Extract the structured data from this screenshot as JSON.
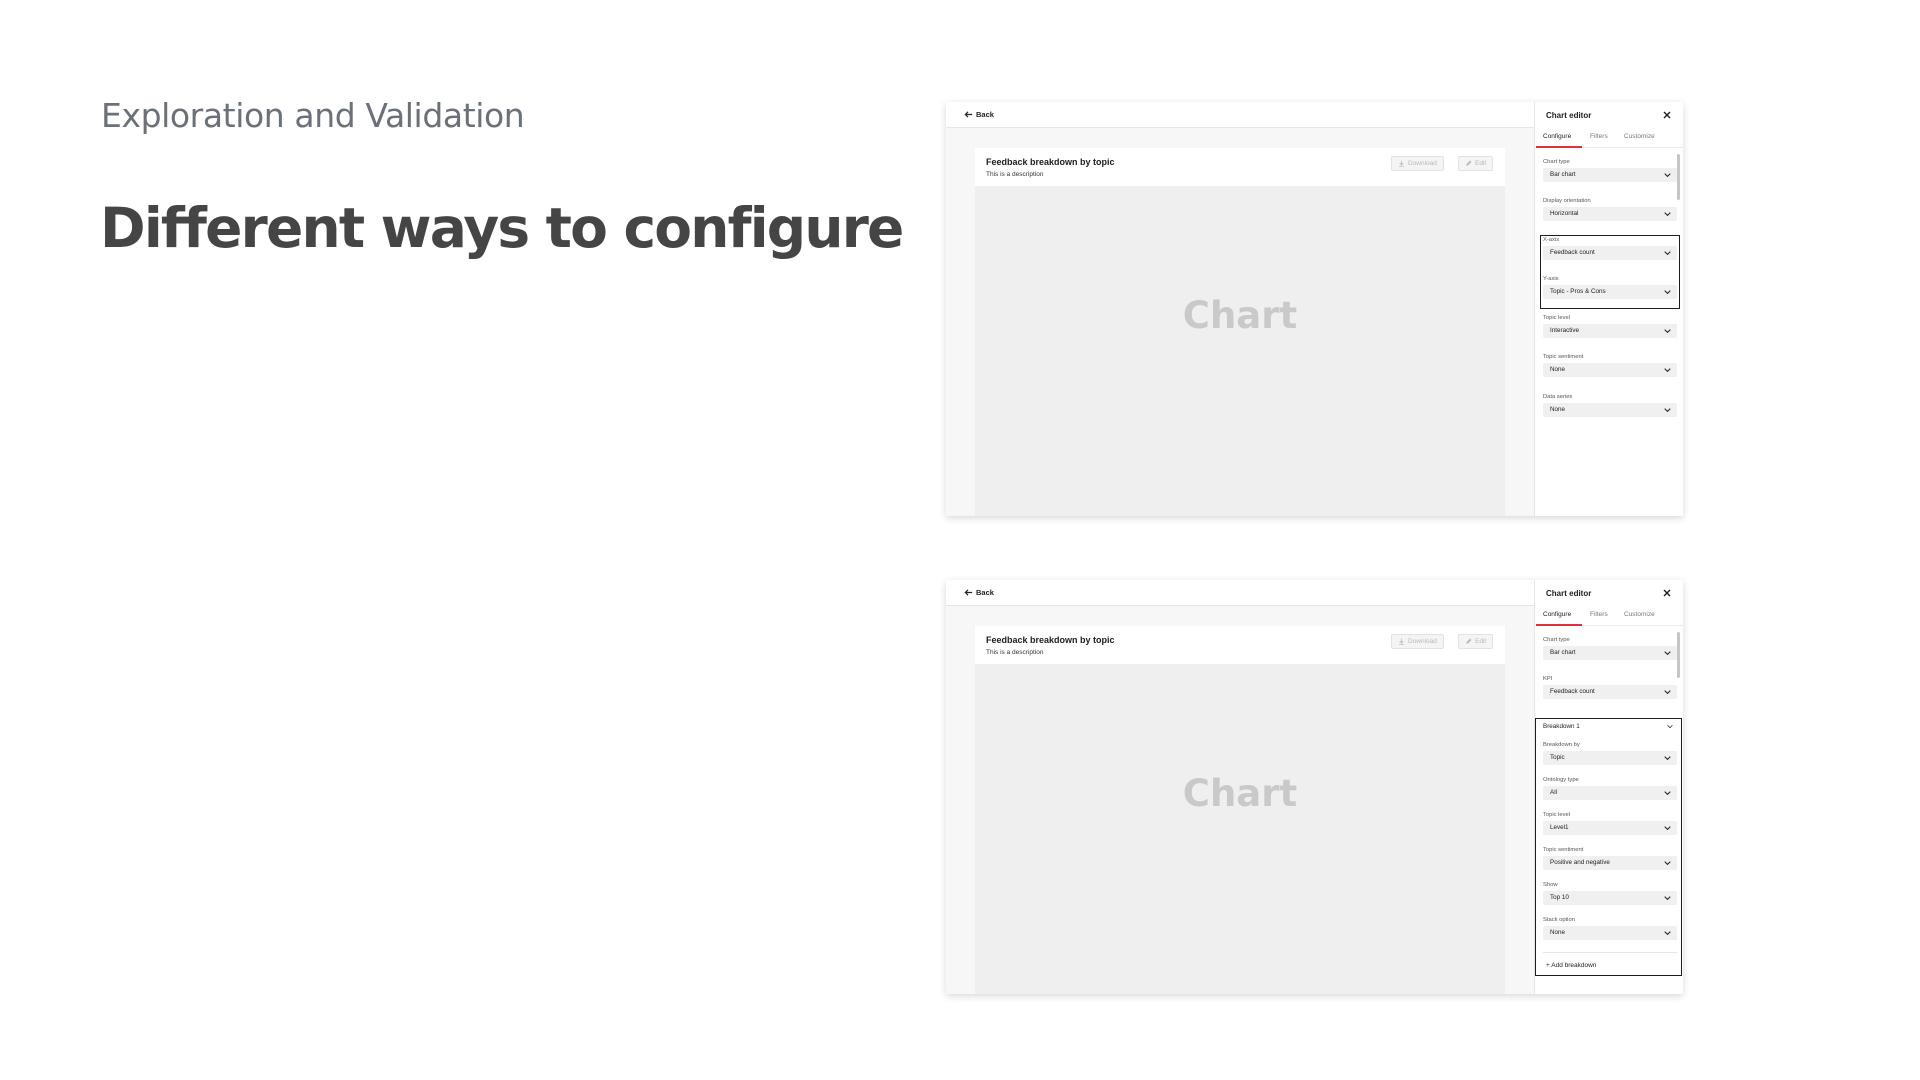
{
  "slide": {
    "subtitle": "Exploration and Validation",
    "title": "Different ways to configure"
  },
  "screens": [
    {
      "back_label": "Back",
      "card": {
        "title": "Feedback breakdown by topic",
        "description": "This is a description",
        "download_label": "Download",
        "edit_label": "Edit",
        "placeholder": "Chart"
      },
      "panel": {
        "title": "Chart editor",
        "tabs": [
          "Configure",
          "Filters",
          "Customize"
        ],
        "fields": [
          {
            "label": "Chart type",
            "value": "Bar chart"
          },
          {
            "label": "Display orientation",
            "value": "Horizontal"
          },
          {
            "label": "X-axis",
            "value": "Feedback count"
          },
          {
            "label": "Y-axis",
            "value": "Topic - Pros & Cons"
          },
          {
            "label": "Topic level",
            "value": "Interactive"
          },
          {
            "label": "Topic sentiment",
            "value": "None"
          },
          {
            "label": "Data series",
            "value": "None"
          }
        ]
      }
    },
    {
      "back_label": "Back",
      "card": {
        "title": "Feedback breakdown by topic",
        "description": "This is a description",
        "download_label": "Download",
        "edit_label": "Edit",
        "placeholder": "Chart"
      },
      "panel": {
        "title": "Chart editor",
        "tabs": [
          "Configure",
          "Filters",
          "Customize"
        ],
        "fields": [
          {
            "label": "Chart type",
            "value": "Bar chart"
          },
          {
            "label": "KPI",
            "value": "Feedback count"
          }
        ],
        "breakdown": {
          "title": "Breakdown 1",
          "fields": [
            {
              "label": "Breakdown by",
              "value": "Topic"
            },
            {
              "label": "Ontology type",
              "value": "All"
            },
            {
              "label": "Topic level",
              "value": "Level1"
            },
            {
              "label": "Topic sentiment",
              "value": "Positive and negative"
            },
            {
              "label": "Show",
              "value": "Top 10"
            },
            {
              "label": "Stack option",
              "value": "None"
            }
          ],
          "add_label": "+ Add breakdown"
        }
      }
    }
  ],
  "colors": {
    "accent": "#e0303a",
    "highlight_border": "#1d1d1f"
  }
}
